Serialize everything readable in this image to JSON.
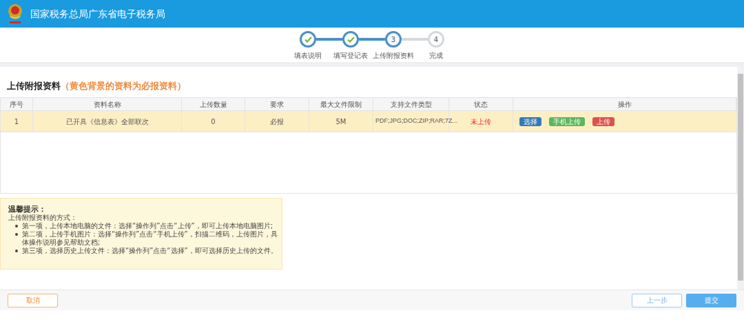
{
  "header": {
    "title": "国家税务总局广东省电子税务局"
  },
  "steps": [
    {
      "label": "填表说明",
      "done": true,
      "current": false
    },
    {
      "label": "填写登记表",
      "done": true,
      "current": false
    },
    {
      "label": "上传附报资料",
      "number": "3",
      "done": false,
      "current": true
    },
    {
      "label": "完成",
      "number": "4",
      "done": false,
      "current": false
    }
  ],
  "section": {
    "title": "上传附报资料",
    "note": "（黄色背景的资料为必报资料）"
  },
  "table": {
    "columns": [
      "序号",
      "资料名称",
      "上传数量",
      "要求",
      "最大文件限制",
      "支持文件类型",
      "状态",
      "操作"
    ],
    "rows": [
      {
        "required": true,
        "cells": [
          "1",
          "已开具《信息表》全部联次",
          "0",
          "必报",
          "5M",
          "PDF;JPG;DOC;ZIP;RAR;7Z..."
        ],
        "status": "未上传",
        "actions": [
          {
            "label": "选择",
            "kind": "primary"
          },
          {
            "label": "手机上传",
            "kind": "success"
          },
          {
            "label": "上传",
            "kind": "danger"
          }
        ]
      }
    ]
  },
  "tips": {
    "title": "温馨提示：",
    "intro": "上传附报资料的方式：",
    "items": [
      "第一项，上传本地电脑的文件：选择“操作列”点击“上传”，即可上传本地电脑图片;",
      "第二项，上传手机图片：选择“操作列”点击“手机上传”，扫描二维码，上传图片，具体操作说明参见帮助文档;",
      "第三项，选择历史上传文件：选择“操作列”点击“选择”，即可选择历史上传的文件。"
    ]
  },
  "footer": {
    "cancel": "取消",
    "prev": "上一步",
    "submit": "提交"
  }
}
